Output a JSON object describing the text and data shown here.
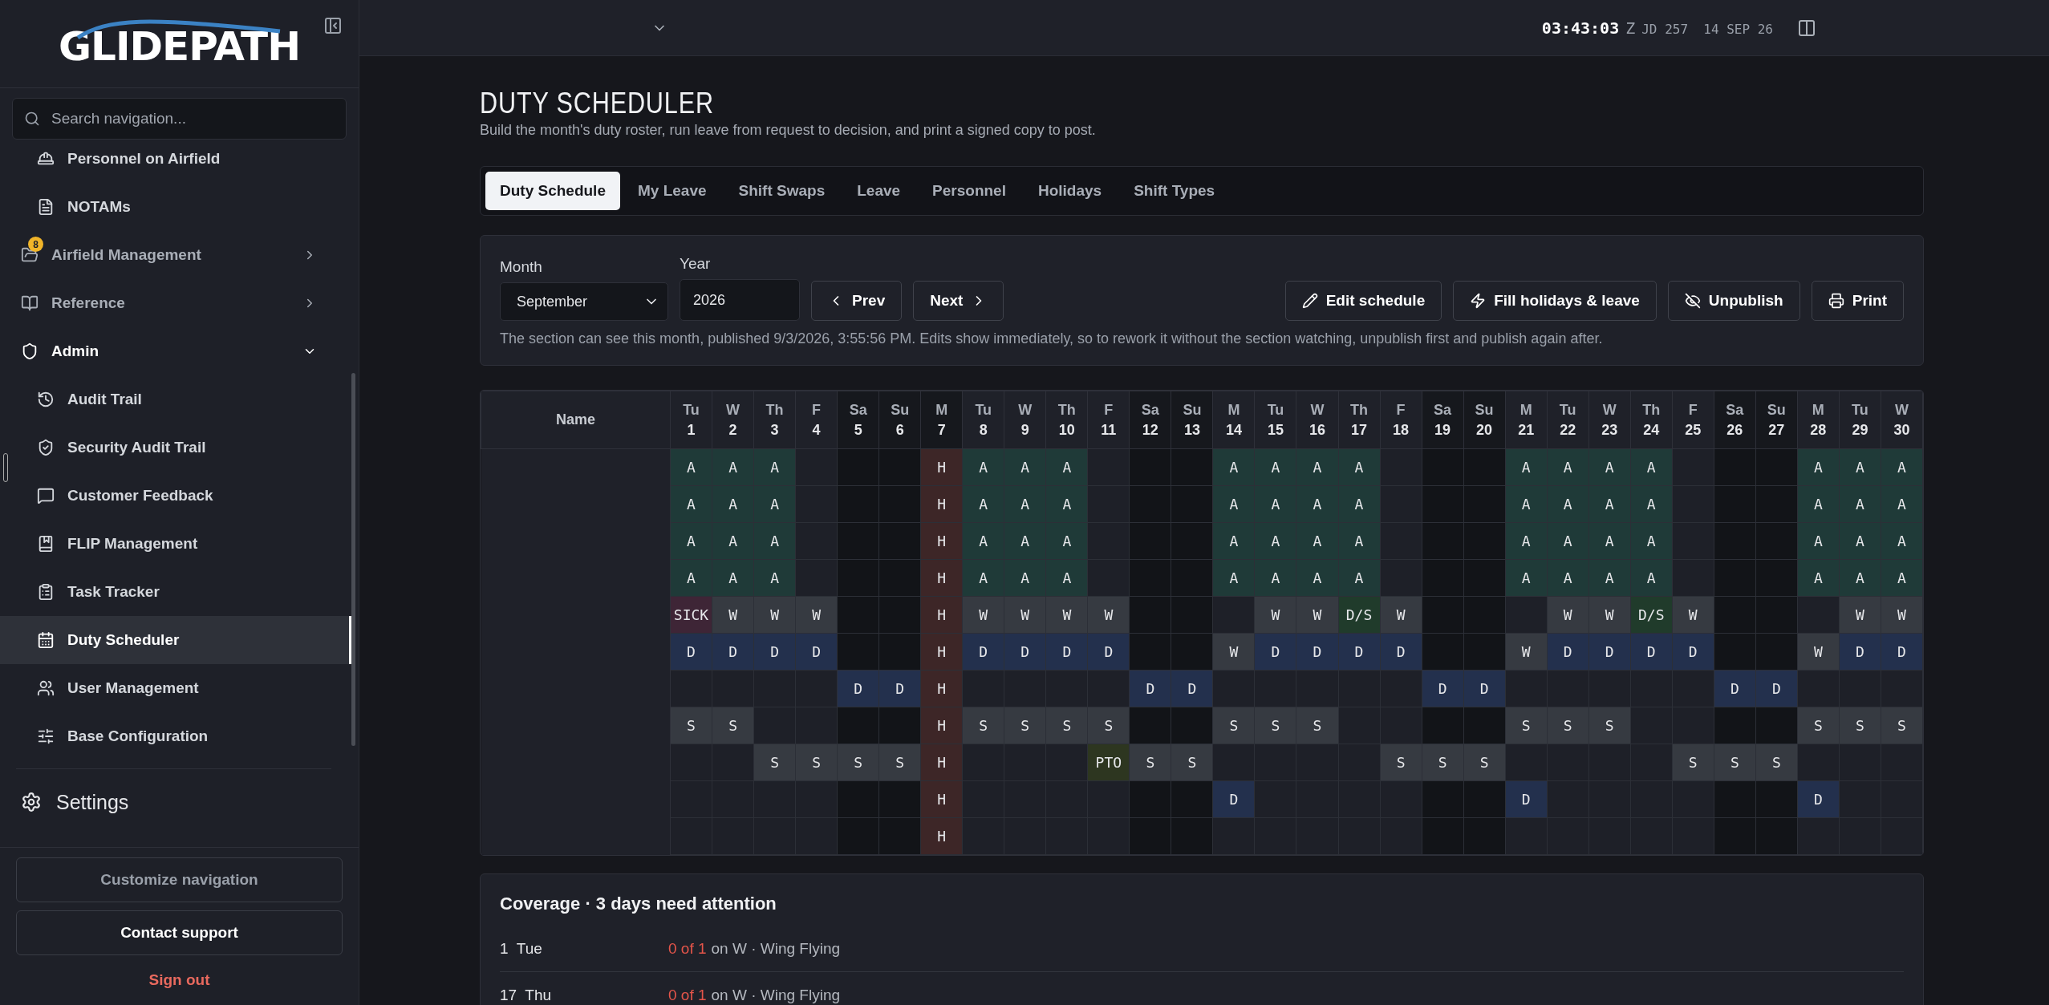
{
  "sidebar": {
    "logo": "GLIDEPATH",
    "search": {
      "placeholder": "Search navigation..."
    },
    "items": [
      {
        "label": "Personnel on Airfield",
        "kind": "link",
        "selected": false
      },
      {
        "label": "NOTAMs",
        "kind": "link",
        "selected": false
      },
      {
        "label": "Airfield Management",
        "kind": "group",
        "expanded": false,
        "badge": "8"
      },
      {
        "label": "Reference",
        "kind": "group",
        "expanded": false
      },
      {
        "label": "Admin",
        "kind": "group",
        "expanded": true,
        "children": [
          {
            "label": "Audit Trail",
            "selected": false
          },
          {
            "label": "Security Audit Trail",
            "selected": false
          },
          {
            "label": "Customer Feedback",
            "selected": false
          },
          {
            "label": "FLIP Management",
            "selected": false
          },
          {
            "label": "Task Tracker",
            "selected": false
          },
          {
            "label": "Duty Scheduler",
            "selected": true
          },
          {
            "label": "User Management",
            "selected": false
          },
          {
            "label": "Base Configuration",
            "selected": false
          }
        ]
      }
    ],
    "settings": "Settings",
    "footer": {
      "customize": "Customize navigation",
      "support": "Contact support",
      "signout": "Sign out"
    }
  },
  "topbar": {
    "time": "03:43:03",
    "zone": "Z",
    "date": "JD 257  14 SEP 26"
  },
  "page": {
    "title": "DUTY SCHEDULER",
    "subtitle": "Build the month's duty roster, run leave from request to decision, and print a signed copy to post."
  },
  "tabs": [
    {
      "label": "Duty Schedule",
      "selected": true
    },
    {
      "label": "My Leave",
      "selected": false
    },
    {
      "label": "Shift Swaps",
      "selected": false
    },
    {
      "label": "Leave",
      "selected": false
    },
    {
      "label": "Personnel",
      "selected": false
    },
    {
      "label": "Holidays",
      "selected": false
    },
    {
      "label": "Shift Types",
      "selected": false
    }
  ],
  "controls": {
    "month_label": "Month",
    "month": "September",
    "year_label": "Year",
    "year": "2026",
    "prev": "Prev",
    "next": "Next",
    "actions": [
      "Edit schedule",
      "Fill holidays & leave",
      "Unpublish",
      "Print"
    ],
    "note": "The section can see this month, published 9/3/2026, 3:55:56 PM. Edits show immediately, so to rework it without the section watching, unpublish first and publish again after."
  },
  "schedule": {
    "name_header": "Name",
    "days": [
      {
        "dow": "Tu",
        "num": "1",
        "kind": "weekday"
      },
      {
        "dow": "W",
        "num": "2",
        "kind": "weekday"
      },
      {
        "dow": "Th",
        "num": "3",
        "kind": "weekday"
      },
      {
        "dow": "F",
        "num": "4",
        "kind": "weekday"
      },
      {
        "dow": "Sa",
        "num": "5",
        "kind": "weekend"
      },
      {
        "dow": "Su",
        "num": "6",
        "kind": "weekend"
      },
      {
        "dow": "M",
        "num": "7",
        "kind": "holiday"
      },
      {
        "dow": "Tu",
        "num": "8",
        "kind": "weekday"
      },
      {
        "dow": "W",
        "num": "9",
        "kind": "weekday"
      },
      {
        "dow": "Th",
        "num": "10",
        "kind": "weekday"
      },
      {
        "dow": "F",
        "num": "11",
        "kind": "weekday"
      },
      {
        "dow": "Sa",
        "num": "12",
        "kind": "weekend"
      },
      {
        "dow": "Su",
        "num": "13",
        "kind": "weekend"
      },
      {
        "dow": "M",
        "num": "14",
        "kind": "weekday"
      },
      {
        "dow": "Tu",
        "num": "15",
        "kind": "weekday"
      },
      {
        "dow": "W",
        "num": "16",
        "kind": "weekday"
      },
      {
        "dow": "Th",
        "num": "17",
        "kind": "weekday"
      },
      {
        "dow": "F",
        "num": "18",
        "kind": "weekday"
      },
      {
        "dow": "Sa",
        "num": "19",
        "kind": "weekend"
      },
      {
        "dow": "Su",
        "num": "20",
        "kind": "weekend"
      },
      {
        "dow": "M",
        "num": "21",
        "kind": "weekday"
      },
      {
        "dow": "Tu",
        "num": "22",
        "kind": "weekday"
      },
      {
        "dow": "W",
        "num": "23",
        "kind": "weekday"
      },
      {
        "dow": "Th",
        "num": "24",
        "kind": "weekday"
      },
      {
        "dow": "F",
        "num": "25",
        "kind": "weekday"
      },
      {
        "dow": "Sa",
        "num": "26",
        "kind": "weekend"
      },
      {
        "dow": "Su",
        "num": "27",
        "kind": "weekend"
      },
      {
        "dow": "M",
        "num": "28",
        "kind": "weekday"
      },
      {
        "dow": "Tu",
        "num": "29",
        "kind": "weekday"
      },
      {
        "dow": "W",
        "num": "30",
        "kind": "weekday"
      }
    ],
    "rows": [
      [
        {
          "text": "A",
          "kind": "alpha"
        },
        {
          "text": "A",
          "kind": "alpha"
        },
        {
          "text": "A",
          "kind": "alpha"
        },
        null,
        null,
        null,
        {
          "text": "H",
          "kind": "holiday"
        },
        {
          "text": "A",
          "kind": "alpha"
        },
        {
          "text": "A",
          "kind": "alpha"
        },
        {
          "text": "A",
          "kind": "alpha"
        },
        null,
        null,
        null,
        {
          "text": "A",
          "kind": "alpha"
        },
        {
          "text": "A",
          "kind": "alpha"
        },
        {
          "text": "A",
          "kind": "alpha"
        },
        {
          "text": "A",
          "kind": "alpha"
        },
        null,
        null,
        null,
        {
          "text": "A",
          "kind": "alpha"
        },
        {
          "text": "A",
          "kind": "alpha"
        },
        {
          "text": "A",
          "kind": "alpha"
        },
        {
          "text": "A",
          "kind": "alpha"
        },
        null,
        null,
        null,
        {
          "text": "A",
          "kind": "alpha"
        },
        {
          "text": "A",
          "kind": "alpha"
        },
        {
          "text": "A",
          "kind": "alpha"
        }
      ],
      [
        {
          "text": "A",
          "kind": "alpha"
        },
        {
          "text": "A",
          "kind": "alpha"
        },
        {
          "text": "A",
          "kind": "alpha"
        },
        null,
        null,
        null,
        {
          "text": "H",
          "kind": "holiday"
        },
        {
          "text": "A",
          "kind": "alpha"
        },
        {
          "text": "A",
          "kind": "alpha"
        },
        {
          "text": "A",
          "kind": "alpha"
        },
        null,
        null,
        null,
        {
          "text": "A",
          "kind": "alpha"
        },
        {
          "text": "A",
          "kind": "alpha"
        },
        {
          "text": "A",
          "kind": "alpha"
        },
        {
          "text": "A",
          "kind": "alpha"
        },
        null,
        null,
        null,
        {
          "text": "A",
          "kind": "alpha"
        },
        {
          "text": "A",
          "kind": "alpha"
        },
        {
          "text": "A",
          "kind": "alpha"
        },
        {
          "text": "A",
          "kind": "alpha"
        },
        null,
        null,
        null,
        {
          "text": "A",
          "kind": "alpha"
        },
        {
          "text": "A",
          "kind": "alpha"
        },
        {
          "text": "A",
          "kind": "alpha"
        }
      ],
      [
        {
          "text": "A",
          "kind": "alpha"
        },
        {
          "text": "A",
          "kind": "alpha"
        },
        {
          "text": "A",
          "kind": "alpha"
        },
        null,
        null,
        null,
        {
          "text": "H",
          "kind": "holiday"
        },
        {
          "text": "A",
          "kind": "alpha"
        },
        {
          "text": "A",
          "kind": "alpha"
        },
        {
          "text": "A",
          "kind": "alpha"
        },
        null,
        null,
        null,
        {
          "text": "A",
          "kind": "alpha"
        },
        {
          "text": "A",
          "kind": "alpha"
        },
        {
          "text": "A",
          "kind": "alpha"
        },
        {
          "text": "A",
          "kind": "alpha"
        },
        null,
        null,
        null,
        {
          "text": "A",
          "kind": "alpha"
        },
        {
          "text": "A",
          "kind": "alpha"
        },
        {
          "text": "A",
          "kind": "alpha"
        },
        {
          "text": "A",
          "kind": "alpha"
        },
        null,
        null,
        null,
        {
          "text": "A",
          "kind": "alpha"
        },
        {
          "text": "A",
          "kind": "alpha"
        },
        {
          "text": "A",
          "kind": "alpha"
        }
      ],
      [
        {
          "text": "A",
          "kind": "alpha"
        },
        {
          "text": "A",
          "kind": "alpha"
        },
        {
          "text": "A",
          "kind": "alpha"
        },
        null,
        null,
        null,
        {
          "text": "H",
          "kind": "holiday"
        },
        {
          "text": "A",
          "kind": "alpha"
        },
        {
          "text": "A",
          "kind": "alpha"
        },
        {
          "text": "A",
          "kind": "alpha"
        },
        null,
        null,
        null,
        {
          "text": "A",
          "kind": "alpha"
        },
        {
          "text": "A",
          "kind": "alpha"
        },
        {
          "text": "A",
          "kind": "alpha"
        },
        {
          "text": "A",
          "kind": "alpha"
        },
        null,
        null,
        null,
        {
          "text": "A",
          "kind": "alpha"
        },
        {
          "text": "A",
          "kind": "alpha"
        },
        {
          "text": "A",
          "kind": "alpha"
        },
        {
          "text": "A",
          "kind": "alpha"
        },
        null,
        null,
        null,
        {
          "text": "A",
          "kind": "alpha"
        },
        {
          "text": "A",
          "kind": "alpha"
        },
        {
          "text": "A",
          "kind": "alpha"
        }
      ],
      [
        {
          "text": "SICK",
          "kind": "sick"
        },
        {
          "text": "W",
          "kind": "plain"
        },
        {
          "text": "W",
          "kind": "plain"
        },
        {
          "text": "W",
          "kind": "plain"
        },
        null,
        null,
        {
          "text": "H",
          "kind": "holiday"
        },
        {
          "text": "W",
          "kind": "plain"
        },
        {
          "text": "W",
          "kind": "plain"
        },
        {
          "text": "W",
          "kind": "plain"
        },
        {
          "text": "W",
          "kind": "plain"
        },
        null,
        null,
        null,
        {
          "text": "W",
          "kind": "plain"
        },
        {
          "text": "W",
          "kind": "plain"
        },
        {
          "text": "D/S",
          "kind": "split"
        },
        {
          "text": "W",
          "kind": "plain"
        },
        null,
        null,
        null,
        {
          "text": "W",
          "kind": "plain"
        },
        {
          "text": "W",
          "kind": "plain"
        },
        {
          "text": "D/S",
          "kind": "split"
        },
        {
          "text": "W",
          "kind": "plain"
        },
        null,
        null,
        null,
        {
          "text": "W",
          "kind": "plain"
        },
        {
          "text": "W",
          "kind": "plain"
        }
      ],
      [
        {
          "text": "D",
          "kind": "duty"
        },
        {
          "text": "D",
          "kind": "duty"
        },
        {
          "text": "D",
          "kind": "duty"
        },
        {
          "text": "D",
          "kind": "duty"
        },
        null,
        null,
        {
          "text": "H",
          "kind": "holiday"
        },
        {
          "text": "D",
          "kind": "duty"
        },
        {
          "text": "D",
          "kind": "duty"
        },
        {
          "text": "D",
          "kind": "duty"
        },
        {
          "text": "D",
          "kind": "duty"
        },
        null,
        null,
        {
          "text": "W",
          "kind": "plain"
        },
        {
          "text": "D",
          "kind": "duty"
        },
        {
          "text": "D",
          "kind": "duty"
        },
        {
          "text": "D",
          "kind": "duty"
        },
        {
          "text": "D",
          "kind": "duty"
        },
        null,
        null,
        {
          "text": "W",
          "kind": "plain"
        },
        {
          "text": "D",
          "kind": "duty"
        },
        {
          "text": "D",
          "kind": "duty"
        },
        {
          "text": "D",
          "kind": "duty"
        },
        {
          "text": "D",
          "kind": "duty"
        },
        null,
        null,
        {
          "text": "W",
          "kind": "plain"
        },
        {
          "text": "D",
          "kind": "duty"
        },
        {
          "text": "D",
          "kind": "duty"
        }
      ],
      [
        null,
        null,
        null,
        null,
        {
          "text": "D",
          "kind": "duty"
        },
        {
          "text": "D",
          "kind": "duty"
        },
        {
          "text": "H",
          "kind": "holiday"
        },
        null,
        null,
        null,
        null,
        {
          "text": "D",
          "kind": "duty"
        },
        {
          "text": "D",
          "kind": "duty"
        },
        null,
        null,
        null,
        null,
        null,
        {
          "text": "D",
          "kind": "duty"
        },
        {
          "text": "D",
          "kind": "duty"
        },
        null,
        null,
        null,
        null,
        null,
        {
          "text": "D",
          "kind": "duty"
        },
        {
          "text": "D",
          "kind": "duty"
        },
        null,
        null,
        null
      ],
      [
        {
          "text": "S",
          "kind": "plain"
        },
        {
          "text": "S",
          "kind": "plain"
        },
        null,
        null,
        null,
        null,
        {
          "text": "H",
          "kind": "holiday"
        },
        {
          "text": "S",
          "kind": "plain"
        },
        {
          "text": "S",
          "kind": "plain"
        },
        {
          "text": "S",
          "kind": "plain"
        },
        {
          "text": "S",
          "kind": "plain"
        },
        null,
        null,
        {
          "text": "S",
          "kind": "plain"
        },
        {
          "text": "S",
          "kind": "plain"
        },
        {
          "text": "S",
          "kind": "plain"
        },
        null,
        null,
        null,
        null,
        {
          "text": "S",
          "kind": "plain"
        },
        {
          "text": "S",
          "kind": "plain"
        },
        {
          "text": "S",
          "kind": "plain"
        },
        null,
        null,
        null,
        null,
        {
          "text": "S",
          "kind": "plain"
        },
        {
          "text": "S",
          "kind": "plain"
        },
        {
          "text": "S",
          "kind": "plain"
        }
      ],
      [
        null,
        null,
        {
          "text": "S",
          "kind": "plain"
        },
        {
          "text": "S",
          "kind": "plain"
        },
        {
          "text": "S",
          "kind": "plain"
        },
        {
          "text": "S",
          "kind": "plain"
        },
        {
          "text": "H",
          "kind": "holiday"
        },
        null,
        null,
        null,
        {
          "text": "PTO",
          "kind": "pto"
        },
        {
          "text": "S",
          "kind": "plain"
        },
        {
          "text": "S",
          "kind": "plain"
        },
        null,
        null,
        null,
        null,
        {
          "text": "S",
          "kind": "plain"
        },
        {
          "text": "S",
          "kind": "plain"
        },
        {
          "text": "S",
          "kind": "plain"
        },
        null,
        null,
        null,
        null,
        {
          "text": "S",
          "kind": "plain"
        },
        {
          "text": "S",
          "kind": "plain"
        },
        {
          "text": "S",
          "kind": "plain"
        },
        null,
        null,
        null
      ],
      [
        null,
        null,
        null,
        null,
        null,
        null,
        {
          "text": "H",
          "kind": "holiday"
        },
        null,
        null,
        null,
        null,
        null,
        null,
        {
          "text": "D",
          "kind": "duty"
        },
        null,
        null,
        null,
        null,
        null,
        null,
        {
          "text": "D",
          "kind": "duty"
        },
        null,
        null,
        null,
        null,
        null,
        null,
        {
          "text": "D",
          "kind": "duty"
        },
        null,
        null
      ],
      [
        null,
        null,
        null,
        null,
        null,
        null,
        {
          "text": "H",
          "kind": "holiday"
        },
        null,
        null,
        null,
        null,
        null,
        null,
        null,
        null,
        null,
        null,
        null,
        null,
        null,
        null,
        null,
        null,
        null,
        null,
        null,
        null,
        null,
        null,
        null
      ]
    ]
  },
  "coverage": {
    "title": "Coverage · 3 days need attention",
    "items": [
      {
        "day": "1",
        "weekday": "Tue",
        "count": "0 of 1",
        "detail": "on W · Wing Flying"
      },
      {
        "day": "17",
        "weekday": "Thu",
        "count": "0 of 1",
        "detail": "on W · Wing Flying"
      }
    ]
  }
}
